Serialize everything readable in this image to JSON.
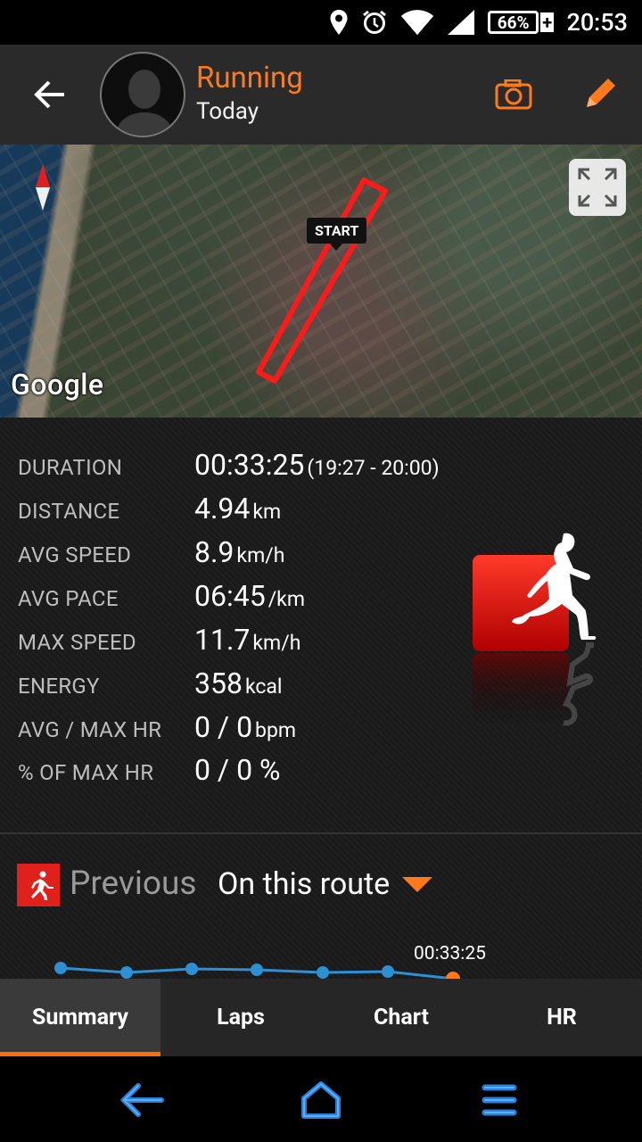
{
  "status_bar": {
    "battery_percent": "66%",
    "battery_charging_symbol": "+",
    "time": "20:53",
    "icons": [
      "location-icon",
      "alarm-icon",
      "wifi-icon",
      "signal-icon",
      "battery-icon"
    ]
  },
  "header": {
    "title": "Running",
    "subtitle": "Today",
    "title_color": "#ff7a1a"
  },
  "map": {
    "start_label": "START",
    "provider_logo": "Google",
    "route_color": "#ff1a1a"
  },
  "stats": [
    {
      "label": "DURATION",
      "value": "00:33:25",
      "unit": "(19:27 - 20:00)"
    },
    {
      "label": "DISTANCE",
      "value": "4.94",
      "unit": "km"
    },
    {
      "label": "AVG SPEED",
      "value": "8.9",
      "unit": "km/h"
    },
    {
      "label": "AVG PACE",
      "value": "06:45",
      "unit": "/km"
    },
    {
      "label": "MAX SPEED",
      "value": "11.7",
      "unit": "km/h"
    },
    {
      "label": "ENERGY",
      "value": "358",
      "unit": "kcal"
    },
    {
      "label": "AVG / MAX HR",
      "value": "0 / 0",
      "unit": "bpm"
    },
    {
      "label": "% OF MAX HR",
      "value": "0 / 0 %",
      "unit": ""
    }
  ],
  "previous": {
    "label": "Previous",
    "selected_option": "On this route",
    "chart_time_label": "00:33:25"
  },
  "tabs": [
    {
      "label": "Summary",
      "active": true
    },
    {
      "label": "Laps",
      "active": false
    },
    {
      "label": "Chart",
      "active": false
    },
    {
      "label": "HR",
      "active": false
    }
  ],
  "colors": {
    "accent": "#ff7a1a",
    "tab_indicator": "#ff6a10",
    "chart_line": "#2d8fd4",
    "brand_red": "#e0201a"
  }
}
